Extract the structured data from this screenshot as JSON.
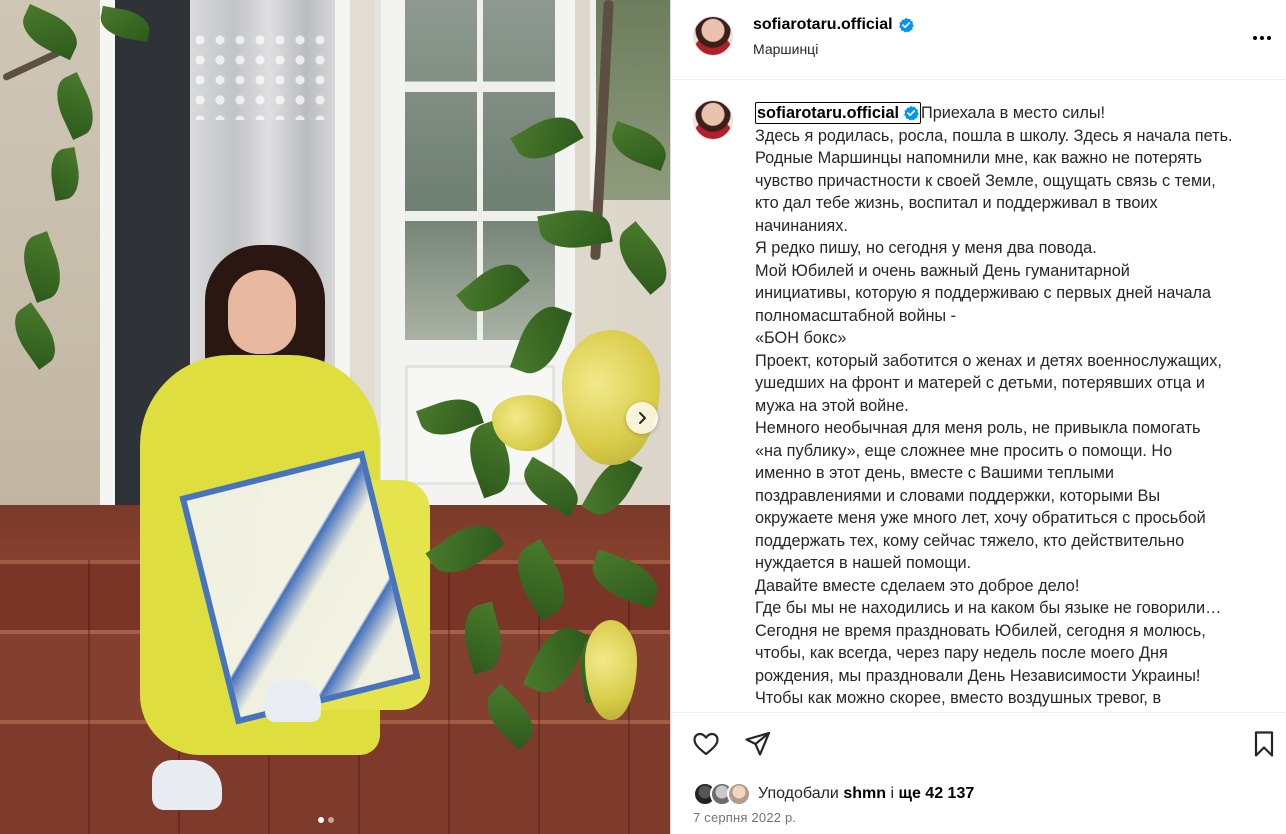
{
  "post": {
    "username": "sofiarotaru.official",
    "location": "Маршинці",
    "caption_lines": [
      "Приехала в место силы!",
      "Здесь я родилась, росла, пошла в школу. Здесь я начала петь.",
      "Родные Маршинцы напомнили мне, как важно не потерять",
      "чувство причастности к своей Земле, ощущать связь с теми,",
      "кто дал тебе жизнь, воспитал и поддерживал в твоих",
      "начинаниях.",
      "Я редко пишу, но сегодня у меня два повода.",
      "Мой Юбилей и очень важный День гуманитарной",
      "инициативы, которую я поддерживаю с первых дней начала",
      "полномасштабной войны -",
      "«БОН бокс»",
      "Проект, который заботится о женах и детях военнослужащих,",
      "ушедших на фронт и матерей с детьми, потерявших отца и",
      "мужа на этой войне.",
      "Немного необычная для меня роль, не привыкла помогать",
      "«на публику», еще сложнее мне просить о помощи. Но",
      "именно в этот день, вместе с Вашими теплыми",
      "поздравлениями и словами поддержки, которыми Вы",
      "окружаете меня уже много лет, хочу обратиться с просьбой",
      "поддержать тех, кому сейчас тяжело, кто действительно",
      "нуждается в нашей помощи.",
      "Давайте вместе сделаем это доброе дело!",
      "Где бы мы не находились и на каком бы языке не говорили…",
      "Сегодня не время праздновать Юбилей, сегодня я молюсь,",
      "чтобы, как всегда, через пару недель после моего Дня",
      "рождения, мы праздновали День Независимости Украины!",
      "Чтобы как можно скорее, вместо воздушных тревог, в"
    ],
    "likes": {
      "prefix": "Уподобали",
      "user": "shmn",
      "connector": "і",
      "count_text": "ще 42 137"
    },
    "date": "7 серпня 2022 р.",
    "carousel": {
      "total": 2,
      "active": 0
    }
  },
  "icons": {
    "verified": "verified-badge-icon",
    "more": "more-options-icon",
    "like": "heart-icon",
    "share": "paper-plane-icon",
    "save": "bookmark-icon",
    "next": "chevron-right-icon"
  },
  "colors": {
    "verified": "#0095f6",
    "text": "#262626",
    "muted": "#737373",
    "border": "#dbdbdb"
  }
}
